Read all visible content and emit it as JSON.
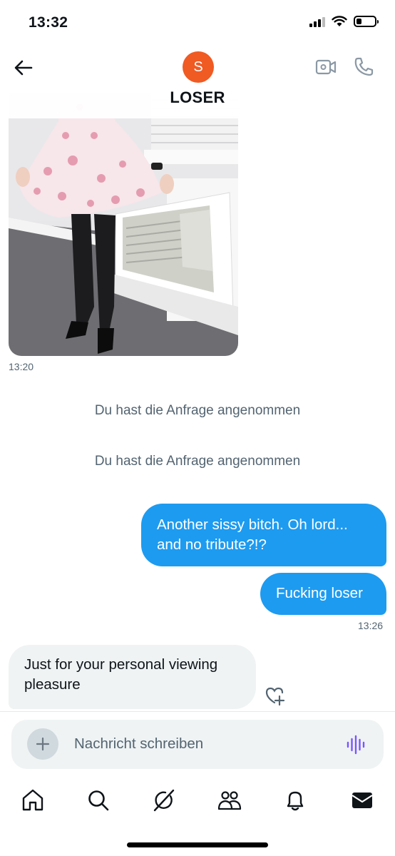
{
  "status_bar": {
    "time": "13:32",
    "signal_icon": "cellular-signal-icon",
    "wifi_icon": "wifi-icon",
    "battery_icon": "battery-icon",
    "battery_level": 0.3
  },
  "header": {
    "back_icon": "arrow-left-icon",
    "avatar_letter": "S",
    "avatar_color": "#f05a23",
    "title": "LOSER",
    "video_icon": "video-call-icon",
    "phone_icon": "phone-call-icon"
  },
  "messages": [
    {
      "type": "image",
      "direction": "incoming",
      "time": "13:20"
    },
    {
      "type": "system",
      "text": "Du hast die Anfrage angenommen"
    },
    {
      "type": "system",
      "text": "Du hast die Anfrage angenommen"
    },
    {
      "type": "text",
      "direction": "outgoing",
      "text_lines": [
        "Another sissy bitch. Oh lord...",
        "and no tribute?!?"
      ]
    },
    {
      "type": "text",
      "direction": "outgoing",
      "text": "Fucking loser",
      "time": "13:26"
    },
    {
      "type": "text",
      "direction": "incoming",
      "text_lines": [
        "Just for your personal viewing",
        "pleasure"
      ],
      "reaction_icon": "add-reaction-heart-icon"
    }
  ],
  "composer": {
    "add_icon": "plus-icon",
    "placeholder": "Nachricht schreiben",
    "value": "",
    "voice_icon": "voice-message-icon",
    "voice_color": "#7856ff"
  },
  "bottom_nav": [
    {
      "name": "home",
      "icon": "home-icon"
    },
    {
      "name": "search",
      "icon": "search-icon"
    },
    {
      "name": "grok",
      "icon": "grok-icon"
    },
    {
      "name": "communities",
      "icon": "communities-icon"
    },
    {
      "name": "notifications",
      "icon": "bell-icon"
    },
    {
      "name": "messages",
      "icon": "mail-icon",
      "active": true
    }
  ],
  "colors": {
    "accent": "#1d9bf0",
    "incoming_bubble": "#eff3f4",
    "secondary_text": "#536471"
  }
}
